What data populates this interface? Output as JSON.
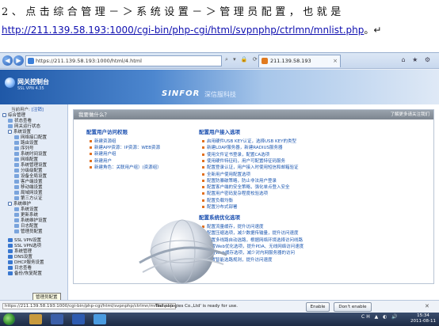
{
  "doc": {
    "line1": "2、点击综合管理－＞系统设置－＞管理员配置，也就是",
    "line2_link": "http://211.139.58.193:1000/cgi-bin/php-cgi/html/svpnphp/ctrlmn/mnlist.php",
    "line2_tail": "。↵"
  },
  "browser": {
    "address": "https://211.139.58.193:1000/html/4.html",
    "tab_title": "211.139.58.193",
    "nav_back": "◀",
    "nav_fwd": "▶",
    "addr_tools": "⌕ ▾ 🔒 ⟳ ✕",
    "window_tools": "⌂ ★ ⚙",
    "tab_close": "×"
  },
  "app": {
    "logo_title": "网关控制台",
    "logo_sub": "SSL VPN 4.35",
    "brand": "SINFOR",
    "brand_cn": "深信服科技"
  },
  "sidebar": {
    "user_label": "当前用户:",
    "user_name": "[注销]",
    "tree": [
      "综合管理",
      "状态查看",
      "网关运行状态",
      "系统设置",
      "网络接口配置",
      "路由设置",
      "序列号",
      "系统时间设置",
      "网络配置",
      "系统管理设置",
      "分级级配置",
      "设备全局设置",
      "客户端设置",
      "移动端设置",
      "局域网设置",
      "第三方认证",
      "系统维护",
      "系统设置",
      "更新系统",
      "系统维护设置",
      "日志配置",
      "管理员配置",
      "SSL VPN设置",
      "SSL VPN选项",
      "系统管理",
      "DNS设置",
      "DHCP服务设置",
      "日志查看",
      "备份/恢复配置"
    ],
    "tooltip": "管理员配置"
  },
  "main": {
    "panel_title": "我要做什么？",
    "panel_right": "了解更多请关注我们",
    "sec1_title": "配置用户访问权限",
    "sec1_items": [
      "新建资源组",
      "新建APP资源：IP资源：WEB资源",
      "新建用户组",
      "新建用户",
      "新建角色：关联用户组）(资源组）"
    ],
    "sec2_title": "配置用户接入选项",
    "sec2_items": [
      "启用硬件USB KEY认证，选择USB KEY的类型",
      "新建LDAP服务器，新建RADIUS服务器",
      "使用文件证书登录，配置CA选项",
      "使用硬件特征码，用户可配置特征码服务",
      "配置登录认证，用户接入时使用短信和邮箱验证",
      "全新用户使用配置选项",
      "配置防暴破策略，防止非法用户登录",
      "配置客户端的安全策略，强化单点登入安全",
      "配置用户密码复杂程度校验选项",
      "配置负载均衡",
      "配置分布式部署"
    ],
    "sec3_title": "配置系统优化选项",
    "sec3_items": [
      "配置流量缓存，提升访问速度",
      "配置压缩选项，减少数据传输量，提升访问速度",
      "配置多线路自动选路，根据网络环境选择访问线路",
      "配置Web优化选项，提升PDA、无线网络访问速度",
      "配置Web缓存选项，减少对内网服务器的访问",
      "配置智能选路规则，提升访问速度"
    ]
  },
  "status": {
    "url": "https://211.139.58.193:1000/cgi-bin/php-cgi/html/svpnphp/ctrlmn/mnlist.php",
    "message": "Technologies Co.,Ltd' is ready for use.",
    "enable": "Enable",
    "dont_enable": "Don't enable",
    "close": "✕"
  },
  "taskbar": {
    "tray": "CH ▲ ◐ 🔊",
    "time": "15:34",
    "date": "2011-08-11"
  }
}
